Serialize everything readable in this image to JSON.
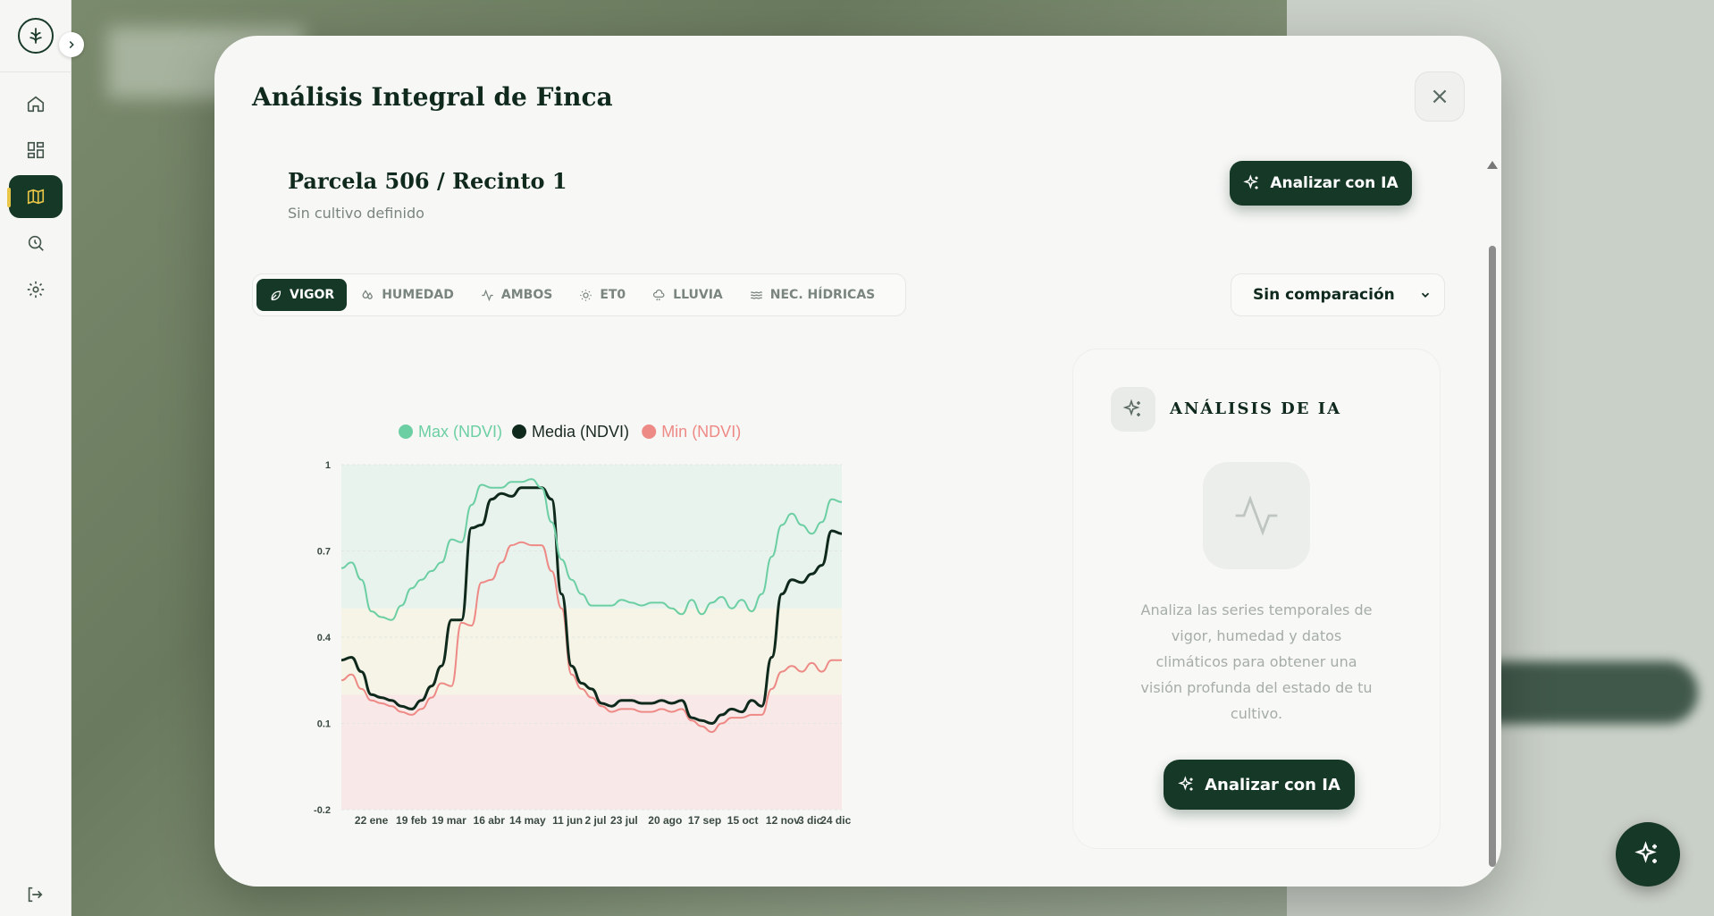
{
  "modal": {
    "title": "Análisis Integral de Finca",
    "close_label": "×"
  },
  "parcel": {
    "title": "Parcela 506 / Recinto 1",
    "subtitle": "Sin cultivo definido",
    "analyze_label": "Analizar con IA"
  },
  "tabs": [
    {
      "label": "VIGOR",
      "icon": "leaf-icon",
      "active": true
    },
    {
      "label": "HUMEDAD",
      "icon": "droplets-icon",
      "active": false
    },
    {
      "label": "AMBOS",
      "icon": "activity-icon",
      "active": false
    },
    {
      "label": "ET0",
      "icon": "sun-icon",
      "active": false
    },
    {
      "label": "LLUVIA",
      "icon": "cloud-rain-icon",
      "active": false
    },
    {
      "label": "NEC. HÍDRICAS",
      "icon": "waves-icon",
      "active": false
    }
  ],
  "compare": {
    "selected": "Sin comparación"
  },
  "ai_panel": {
    "title": "ANÁLISIS DE IA",
    "description": "Analiza las series temporales de vigor, humedad y datos climáticos para obtener una visión profunda del estado de tu cultivo.",
    "button_label": "Analizar con IA"
  },
  "colors": {
    "accent": "#163826",
    "highlight": "#e8c547",
    "max": "#6ccfa3",
    "media": "#0f2a1c",
    "min": "#ee8a86"
  },
  "chart_data": {
    "type": "line",
    "title": "",
    "xlabel": "",
    "ylabel": "",
    "ylim": [
      -0.2,
      1
    ],
    "yticks": [
      1,
      0.7,
      0.4,
      0.1,
      -0.2
    ],
    "xticks": [
      "22 ene",
      "19 feb",
      "19 mar",
      "16 abr",
      "14 may",
      "11 jun",
      "2 jul",
      "23 jul",
      "20 ago",
      "17 sep",
      "15 oct",
      "12 nov",
      "3 dic",
      "24 dic"
    ],
    "legend": {
      "position": "top-center"
    },
    "bands": [
      {
        "from": 0.5,
        "to": 1,
        "color": "#e9f3ee"
      },
      {
        "from": 0.2,
        "to": 0.5,
        "color": "#f6f4e6"
      },
      {
        "from": -0.2,
        "to": 0.2,
        "color": "#f8e9e8"
      }
    ],
    "series": [
      {
        "name": "Max (NDVI)",
        "color": "#6ccfa3",
        "values": [
          0.64,
          0.66,
          0.6,
          0.49,
          0.47,
          0.46,
          0.51,
          0.57,
          0.6,
          0.63,
          0.66,
          0.74,
          0.73,
          0.86,
          0.93,
          0.92,
          0.92,
          0.94,
          0.94,
          0.95,
          0.92,
          0.8,
          0.67,
          0.6,
          0.55,
          0.51,
          0.51,
          0.51,
          0.53,
          0.52,
          0.51,
          0.52,
          0.52,
          0.5,
          0.48,
          0.53,
          0.48,
          0.52,
          0.54,
          0.5,
          0.53,
          0.49,
          0.55,
          0.68,
          0.79,
          0.83,
          0.79,
          0.76,
          0.8,
          0.88,
          0.87
        ]
      },
      {
        "name": "Media (NDVI)",
        "color": "#0f2a1c",
        "values": [
          0.32,
          0.33,
          0.28,
          0.2,
          0.19,
          0.18,
          0.16,
          0.15,
          0.18,
          0.23,
          0.3,
          0.46,
          0.46,
          0.78,
          0.79,
          0.88,
          0.9,
          0.89,
          0.92,
          0.92,
          0.92,
          0.88,
          0.55,
          0.3,
          0.24,
          0.22,
          0.17,
          0.16,
          0.18,
          0.18,
          0.17,
          0.17,
          0.18,
          0.17,
          0.18,
          0.12,
          0.11,
          0.1,
          0.13,
          0.15,
          0.14,
          0.18,
          0.16,
          0.33,
          0.55,
          0.6,
          0.59,
          0.62,
          0.65,
          0.77,
          0.76
        ]
      },
      {
        "name": "Min (NDVI)",
        "color": "#ee8a86",
        "values": [
          0.25,
          0.27,
          0.22,
          0.18,
          0.17,
          0.16,
          0.14,
          0.13,
          0.15,
          0.19,
          0.24,
          0.23,
          0.45,
          0.44,
          0.59,
          0.6,
          0.66,
          0.72,
          0.73,
          0.72,
          0.72,
          0.63,
          0.5,
          0.27,
          0.22,
          0.19,
          0.16,
          0.14,
          0.15,
          0.15,
          0.14,
          0.14,
          0.15,
          0.14,
          0.15,
          0.11,
          0.09,
          0.07,
          0.1,
          0.12,
          0.12,
          0.13,
          0.13,
          0.22,
          0.28,
          0.3,
          0.28,
          0.31,
          0.28,
          0.32,
          0.32
        ]
      }
    ]
  }
}
